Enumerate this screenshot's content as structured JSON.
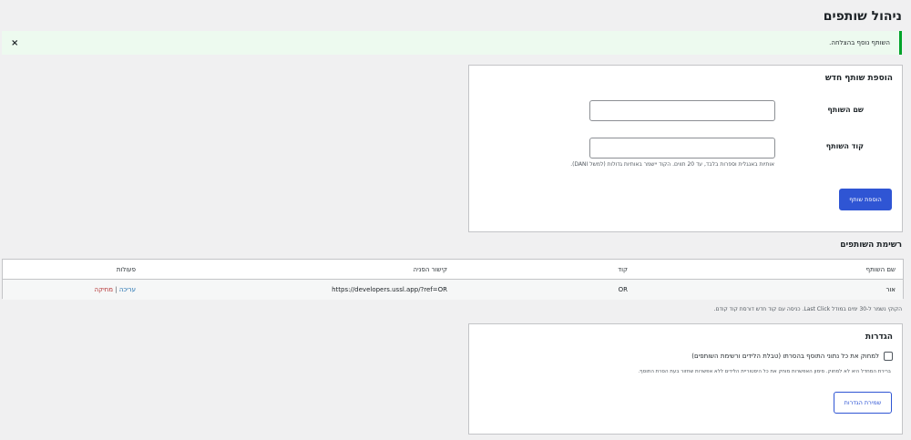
{
  "page": {
    "title": "ניהול שותפים"
  },
  "notice": {
    "text": "השותף נוסף בהצלחה.",
    "close": "×"
  },
  "add_partner": {
    "title": "הוספת שותף חדש",
    "name_label": "שם השותף",
    "name_value": "",
    "code_label": "קוד השותף",
    "code_value": "",
    "hint": "אותיות באנגלית וספרות בלבד, עד 20 תווים. הקוד יישמר באותיות גדולות (למשל DANI).",
    "submit_label": "הוספת שותף"
  },
  "partners": {
    "title": "רשימת השותפים",
    "columns": [
      "שם השותף",
      "קוד",
      "קישור הפניה",
      "פעולות"
    ],
    "rows": [
      {
        "name": "אור",
        "code": "OR",
        "url": "https://developers.ussl.app/?ref=OR",
        "edit": "עריכה",
        "separator": "|",
        "delete": "מחיקה"
      }
    ],
    "note": "הקוקי נשמר ל-30 ימים במודל Last Click. כניסה עם קוד חדש דורסת קוד קודם."
  },
  "settings": {
    "title": "הגדרות",
    "checkbox_label": "למחוק את כל נתוני התוסף בהסרתו (טבלת הלידים ורשימת השותפים)",
    "checkbox_checked": false,
    "note": "ברירת המחדל היא לא למחוק. סימון האפשרות מוחק את כל היסטוריית הלידים ללא אפשרות שחזור בעת הסרת התוסף.",
    "save_label": "שמירת הגדרות"
  },
  "colors": {
    "accent": "#2f55d4",
    "success": "#00a32a",
    "danger": "#b32d2e",
    "link": "#2271b1"
  }
}
